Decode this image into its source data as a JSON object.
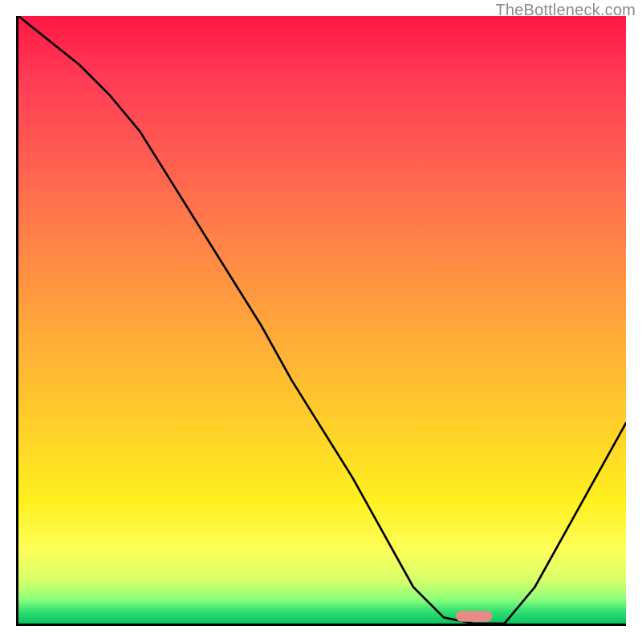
{
  "watermark": "TheBottleneck.com",
  "chart_data": {
    "type": "line",
    "title": "",
    "xlabel": "",
    "ylabel": "",
    "xlim": [
      0,
      100
    ],
    "ylim": [
      0,
      100
    ],
    "grid": false,
    "series": [
      {
        "name": "bottleneck-curve",
        "x": [
          0,
          5,
          10,
          15,
          20,
          25,
          30,
          35,
          40,
          45,
          50,
          55,
          60,
          65,
          70,
          75,
          80,
          85,
          90,
          95,
          100
        ],
        "y": [
          100,
          96,
          92,
          87,
          81,
          73,
          65,
          57,
          49,
          40,
          32,
          24,
          15,
          6,
          1,
          0,
          0,
          6,
          15,
          24,
          33
        ]
      }
    ],
    "marker": {
      "name": "optimal-range-marker",
      "x_start": 72,
      "x_end": 78,
      "y": 1.2,
      "color": "#e88a88"
    },
    "background_gradient_stops": [
      {
        "pos": 0,
        "color": "#ff1744"
      },
      {
        "pos": 10,
        "color": "#ff3b55"
      },
      {
        "pos": 22,
        "color": "#ff5a52"
      },
      {
        "pos": 34,
        "color": "#ff7a4a"
      },
      {
        "pos": 46,
        "color": "#ff9a3f"
      },
      {
        "pos": 58,
        "color": "#ffb833"
      },
      {
        "pos": 70,
        "color": "#ffd727"
      },
      {
        "pos": 80,
        "color": "#fff01f"
      },
      {
        "pos": 88,
        "color": "#fdff5a"
      },
      {
        "pos": 93,
        "color": "#d6ff6b"
      },
      {
        "pos": 96,
        "color": "#8dff7a"
      },
      {
        "pos": 98,
        "color": "#30e070"
      },
      {
        "pos": 100,
        "color": "#0bc060"
      }
    ]
  }
}
